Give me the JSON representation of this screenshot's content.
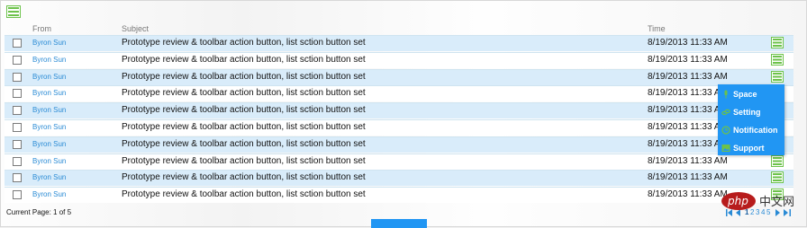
{
  "header": {
    "from_label": "From",
    "subject_label": "Subject",
    "time_label": "Time",
    "toolbar_icon": "list-icon"
  },
  "rows": [
    {
      "from": "Byron Sun",
      "subject": "Prototype review & toolbar action button, list sction button set",
      "time": "8/19/2013 11:33 AM",
      "highlight": true
    },
    {
      "from": "Byron Sun",
      "subject": "Prototype review & toolbar action button, list sction button set",
      "time": "8/19/2013 11:33 AM",
      "highlight": false
    },
    {
      "from": "Byron Sun",
      "subject": "Prototype review & toolbar action button, list sction button set",
      "time": "8/19/2013 11:33 AM",
      "highlight": true
    },
    {
      "from": "Byron Sun",
      "subject": "Prototype review & toolbar action button, list sction button set",
      "time": "8/19/2013 11:33 AM",
      "highlight": false
    },
    {
      "from": "Byron Sun",
      "subject": "Prototype review & toolbar action button, list sction button set",
      "time": "8/19/2013 11:33 AM",
      "highlight": true
    },
    {
      "from": "Byron Sun",
      "subject": "Prototype review & toolbar action button, list sction button set",
      "time": "8/19/2013 11:33 AM",
      "highlight": false
    },
    {
      "from": "Byron Sun",
      "subject": "Prototype review & toolbar action button, list sction button set",
      "time": "8/19/2013 11:33 AM",
      "highlight": true
    },
    {
      "from": "Byron Sun",
      "subject": "Prototype review & toolbar action button, list sction button set",
      "time": "8/19/2013 11:33 AM",
      "highlight": false
    },
    {
      "from": "Byron Sun",
      "subject": "Prototype review & toolbar action button, list sction button set",
      "time": "8/19/2013 11:33 AM",
      "highlight": true
    },
    {
      "from": "Byron Sun",
      "subject": "Prototype review & toolbar action button, list sction button set",
      "time": "8/19/2013 11:33 AM",
      "highlight": false
    }
  ],
  "menu": {
    "items": [
      {
        "label": "Space",
        "icon": "microphone-icon"
      },
      {
        "label": "Setting",
        "icon": "link-icon"
      },
      {
        "label": "Notification",
        "icon": "clock-icon"
      },
      {
        "label": "Support",
        "icon": "image-icon"
      }
    ]
  },
  "footer": {
    "current_page_text": "Current Page: 1 of 5"
  },
  "pager": {
    "pages": [
      "1",
      "2",
      "3",
      "4",
      "5"
    ],
    "current": "1"
  },
  "watermark": {
    "text": "中文网",
    "logo_text": "php"
  },
  "colors": {
    "accent": "#2196f3",
    "link": "#2a8bd5",
    "icon_green": "#6cc24a",
    "row_highlight": "#d9ecfa"
  }
}
